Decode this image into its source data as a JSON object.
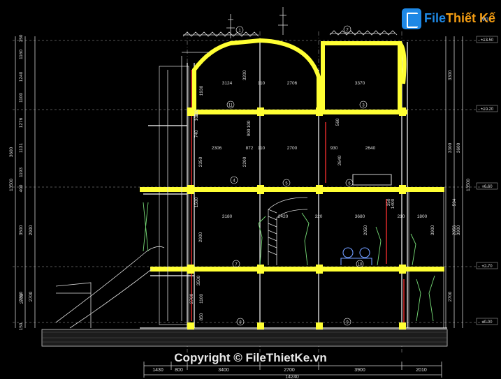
{
  "watermark": {
    "logo_part1": "File",
    "logo_part2": "Thiết Kế",
    "logo_domain": ".vn",
    "copyright": "Copyright © FileThietKe.vn"
  },
  "colors": {
    "background": "#000000",
    "slab": "#ffff33",
    "wall": "#ffffff",
    "dimension": "#d0d0d0",
    "rebar": "#ff3030",
    "ornament": "#77dd77",
    "axis_bubble": "#ffffff",
    "logo_blue": "#1e88e5",
    "logo_orange": "#f39c12"
  },
  "levels": [
    {
      "id": "roof",
      "label": "+13.50"
    },
    {
      "id": "f3",
      "label": "+10.20"
    },
    {
      "id": "f2",
      "label": "+6.60"
    },
    {
      "id": "f1",
      "label": "+2.70"
    },
    {
      "id": "gl",
      "label": "±0.00"
    }
  ],
  "axis_markers": [
    "1",
    "2",
    "3",
    "4",
    "5",
    "6",
    "7",
    "8",
    "9",
    "10",
    "11"
  ],
  "left_dims_outer": [
    "350",
    "1160",
    "1240",
    "1100",
    "1276",
    "1131",
    "1193",
    "400",
    "3500",
    "2700",
    "150"
  ],
  "left_dims_inner": [
    "3600",
    "13500",
    "2900",
    "2700"
  ],
  "right_dims": [
    "3300",
    "3300",
    "3600",
    "3900",
    "2700",
    "13500"
  ],
  "room_dims": [
    "3124",
    "110",
    "2706",
    "3200",
    "3370",
    "1930",
    "2306",
    "872",
    "110",
    "2700",
    "930",
    "2640",
    "2350",
    "2200",
    "2640",
    "560",
    "100",
    "740",
    "300",
    "100",
    "900",
    "3180",
    "2420",
    "320",
    "3680",
    "210",
    "1800",
    "2900",
    "1500",
    "2050",
    "2056",
    "3900",
    "350",
    "594",
    "1400",
    "2700",
    "2700",
    "1100",
    "850",
    "3500"
  ],
  "bottom_dims": [
    "1430",
    "800",
    "3400",
    "2700",
    "3900",
    "2010"
  ],
  "bottom_total": "14240"
}
